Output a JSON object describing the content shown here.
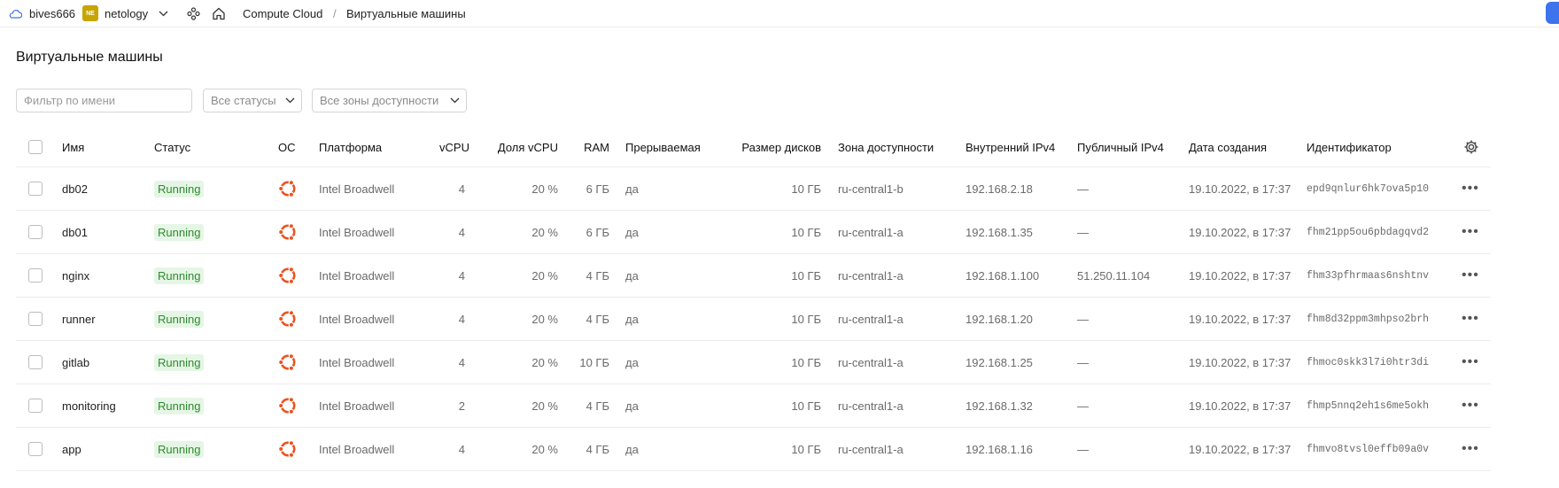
{
  "topbar": {
    "cloud_name": "bives666",
    "org_badge": "NE",
    "org_name": "netology",
    "service": "Compute Cloud",
    "separator": "/",
    "current_page": "Виртуальные машины"
  },
  "page": {
    "title": "Виртуальные машины",
    "filter_placeholder": "Фильтр по имени",
    "status_select": "Все статусы",
    "zone_select": "Все зоны доступности"
  },
  "table": {
    "headers": {
      "name": "Имя",
      "status": "Статус",
      "os": "ОС",
      "platform": "Платформа",
      "vcpu": "vCPU",
      "vcpu_share": "Доля vCPU",
      "ram": "RAM",
      "preemptible": "Прерываемая",
      "disk_size": "Размер дисков",
      "zone": "Зона доступности",
      "internal_ip": "Внутренний IPv4",
      "public_ip": "Публичный IPv4",
      "created": "Дата создания",
      "id": "Идентификатор"
    },
    "rows": [
      {
        "name": "db02",
        "status": "Running",
        "platform": "Intel Broadwell",
        "vcpu": "4",
        "vcpu_share": "20 %",
        "ram": "6 ГБ",
        "preemptible": "да",
        "disk_size": "10 ГБ",
        "zone": "ru-central1-b",
        "internal_ip": "192.168.2.18",
        "public_ip": "—",
        "created": "19.10.2022, в 17:37",
        "id": "epd9qnlur6hk7ova5p10"
      },
      {
        "name": "db01",
        "status": "Running",
        "platform": "Intel Broadwell",
        "vcpu": "4",
        "vcpu_share": "20 %",
        "ram": "6 ГБ",
        "preemptible": "да",
        "disk_size": "10 ГБ",
        "zone": "ru-central1-a",
        "internal_ip": "192.168.1.35",
        "public_ip": "—",
        "created": "19.10.2022, в 17:37",
        "id": "fhm21pp5ou6pbdagqvd2"
      },
      {
        "name": "nginx",
        "status": "Running",
        "platform": "Intel Broadwell",
        "vcpu": "4",
        "vcpu_share": "20 %",
        "ram": "4 ГБ",
        "preemptible": "да",
        "disk_size": "10 ГБ",
        "zone": "ru-central1-a",
        "internal_ip": "192.168.1.100",
        "public_ip": "51.250.11.104",
        "created": "19.10.2022, в 17:37",
        "id": "fhm33pfhrmaas6nshtnv"
      },
      {
        "name": "runner",
        "status": "Running",
        "platform": "Intel Broadwell",
        "vcpu": "4",
        "vcpu_share": "20 %",
        "ram": "4 ГБ",
        "preemptible": "да",
        "disk_size": "10 ГБ",
        "zone": "ru-central1-a",
        "internal_ip": "192.168.1.20",
        "public_ip": "—",
        "created": "19.10.2022, в 17:37",
        "id": "fhm8d32ppm3mhpso2brh"
      },
      {
        "name": "gitlab",
        "status": "Running",
        "platform": "Intel Broadwell",
        "vcpu": "4",
        "vcpu_share": "20 %",
        "ram": "10 ГБ",
        "preemptible": "да",
        "disk_size": "10 ГБ",
        "zone": "ru-central1-a",
        "internal_ip": "192.168.1.25",
        "public_ip": "—",
        "created": "19.10.2022, в 17:37",
        "id": "fhmoc0skk3l7i0htr3di"
      },
      {
        "name": "monitoring",
        "status": "Running",
        "platform": "Intel Broadwell",
        "vcpu": "2",
        "vcpu_share": "20 %",
        "ram": "4 ГБ",
        "preemptible": "да",
        "disk_size": "10 ГБ",
        "zone": "ru-central1-a",
        "internal_ip": "192.168.1.32",
        "public_ip": "—",
        "created": "19.10.2022, в 17:37",
        "id": "fhmp5nnq2eh1s6me5okh"
      },
      {
        "name": "app",
        "status": "Running",
        "platform": "Intel Broadwell",
        "vcpu": "4",
        "vcpu_share": "20 %",
        "ram": "4 ГБ",
        "preemptible": "да",
        "disk_size": "10 ГБ",
        "zone": "ru-central1-a",
        "internal_ip": "192.168.1.16",
        "public_ip": "—",
        "created": "19.10.2022, в 17:37",
        "id": "fhmvo8tvsl0effb09a0v"
      }
    ],
    "row_actions_glyph": "•••"
  },
  "icons": {
    "cloud": "cloud-icon",
    "chevron": "chevron-down-icon",
    "services": "services-icon",
    "home": "home-icon",
    "settings": "gear-icon",
    "os": "ubuntu-icon"
  },
  "colors": {
    "status_running_bg": "#e6f6e6",
    "status_running_text": "#2e8b2e",
    "os_icon": "#e95420",
    "org_badge": "#c8a400",
    "corner_button": "#3e73ee"
  }
}
